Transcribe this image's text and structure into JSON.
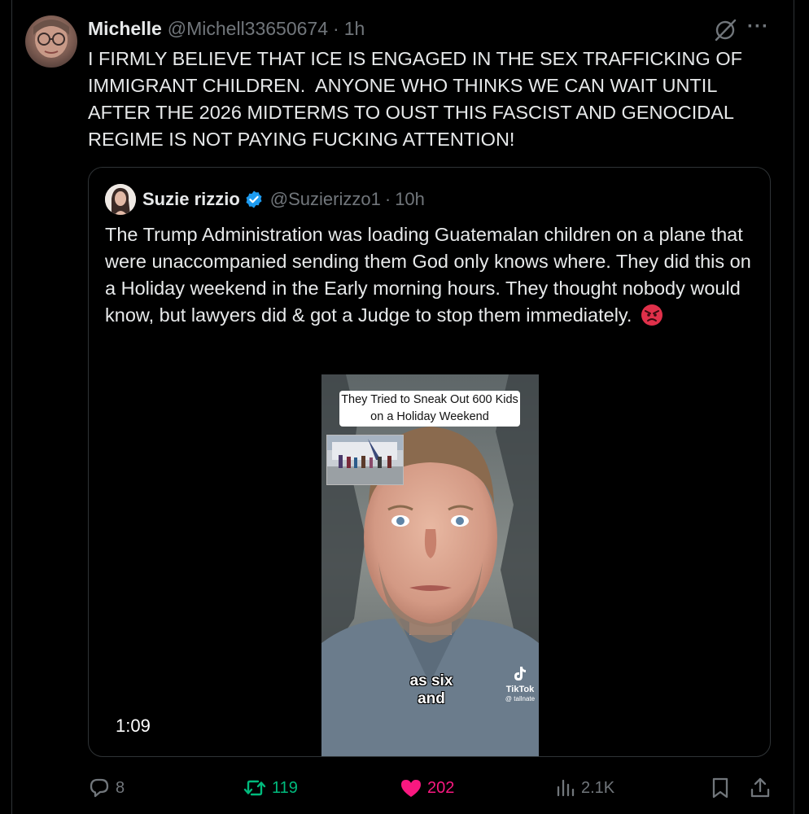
{
  "post": {
    "display_name": "Michelle",
    "handle": "@Michell33650674",
    "separator": "·",
    "time": "1h",
    "more": "···",
    "text": "I FIRMLY BELIEVE THAT ICE IS ENGAGED IN THE SEX TRAFFICKING OF IMMIGRANT CHILDREN.  ANYONE WHO THINKS WE CAN WAIT UNTIL AFTER THE 2026 MIDTERMS TO OUST THIS FASCIST AND GENOCIDAL REGIME IS NOT PAYING FUCKING ATTENTION!"
  },
  "quote": {
    "display_name": "Suzie rizzio",
    "handle": "@Suzierizzo1",
    "separator": "·",
    "time": "10h",
    "text": "The Trump Administration was loading Guatemalan children on a plane that were unaccompanied sending them God only knows where. They did this on a Holiday weekend in the Early morning hours. They thought nobody would know, but lawyers did & got a Judge to stop them immediately.",
    "emoji": "angry-face",
    "video": {
      "caption": "They Tried to Sneak Out 600 Kids on a Holiday Weekend",
      "subtitle": "as six and",
      "watermark_brand": "TikTok",
      "watermark_handle": "@ tallnate",
      "duration": "1:09"
    }
  },
  "actions": {
    "replies": "8",
    "reposts": "119",
    "likes": "202",
    "views": "2.1K"
  },
  "colors": {
    "background": "#000000",
    "text": "#e7e9ea",
    "muted": "#71767b",
    "border": "#2f3336",
    "verified": "#1d9bf0",
    "repost_active": "#00ba7c",
    "like_active": "#f91880"
  }
}
